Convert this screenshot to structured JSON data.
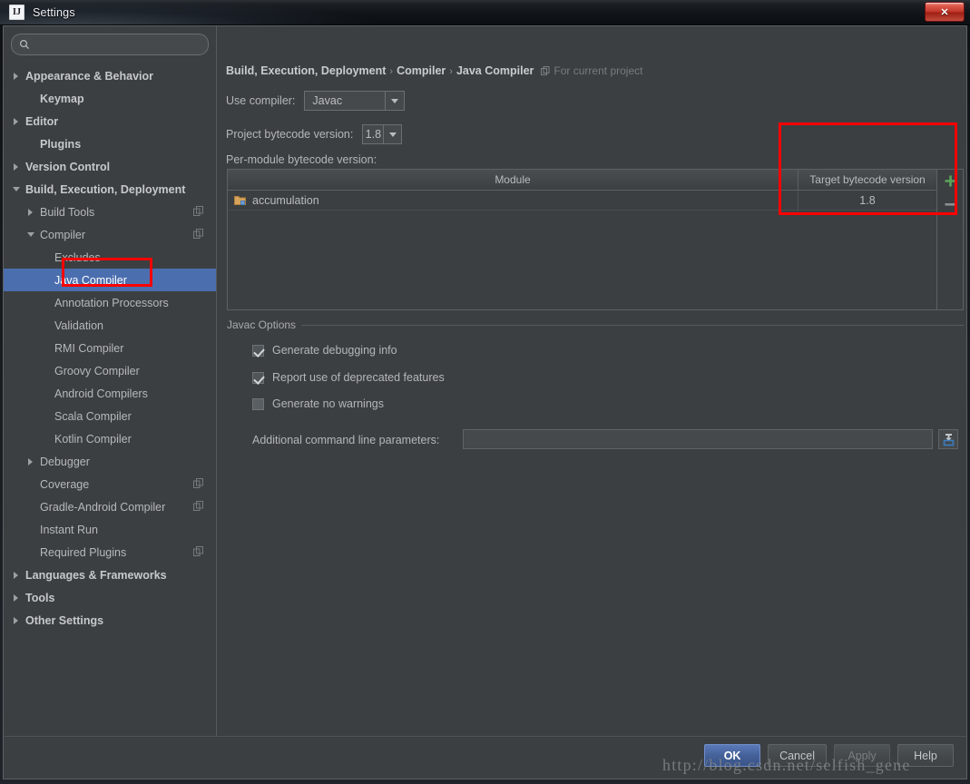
{
  "window": {
    "title": "Settings",
    "logo_text": "IJ",
    "close_label": "✕"
  },
  "search": {
    "value": "",
    "placeholder": "",
    "icon": "search-icon"
  },
  "sidebar": {
    "items": [
      {
        "label": "Appearance & Behavior",
        "indent": 0,
        "twisty": "right",
        "bold": true,
        "copy": false,
        "selected": false
      },
      {
        "label": "Keymap",
        "indent": 1,
        "twisty": "none",
        "bold": true,
        "copy": false,
        "selected": false
      },
      {
        "label": "Editor",
        "indent": 0,
        "twisty": "right",
        "bold": true,
        "copy": false,
        "selected": false
      },
      {
        "label": "Plugins",
        "indent": 1,
        "twisty": "none",
        "bold": true,
        "copy": false,
        "selected": false
      },
      {
        "label": "Version Control",
        "indent": 0,
        "twisty": "right",
        "bold": true,
        "copy": false,
        "selected": false
      },
      {
        "label": "Build, Execution, Deployment",
        "indent": 0,
        "twisty": "down",
        "bold": true,
        "copy": false,
        "selected": false
      },
      {
        "label": "Build Tools",
        "indent": 1,
        "twisty": "right",
        "bold": false,
        "copy": true,
        "selected": false
      },
      {
        "label": "Compiler",
        "indent": 1,
        "twisty": "down",
        "bold": false,
        "copy": true,
        "selected": false
      },
      {
        "label": "Excludes",
        "indent": 2,
        "twisty": "none",
        "bold": false,
        "copy": false,
        "selected": false
      },
      {
        "label": "Java Compiler",
        "indent": 2,
        "twisty": "none",
        "bold": false,
        "copy": false,
        "selected": true
      },
      {
        "label": "Annotation Processors",
        "indent": 2,
        "twisty": "none",
        "bold": false,
        "copy": false,
        "selected": false
      },
      {
        "label": "Validation",
        "indent": 2,
        "twisty": "none",
        "bold": false,
        "copy": false,
        "selected": false
      },
      {
        "label": "RMI Compiler",
        "indent": 2,
        "twisty": "none",
        "bold": false,
        "copy": false,
        "selected": false
      },
      {
        "label": "Groovy Compiler",
        "indent": 2,
        "twisty": "none",
        "bold": false,
        "copy": false,
        "selected": false
      },
      {
        "label": "Android Compilers",
        "indent": 2,
        "twisty": "none",
        "bold": false,
        "copy": false,
        "selected": false
      },
      {
        "label": "Scala Compiler",
        "indent": 2,
        "twisty": "none",
        "bold": false,
        "copy": false,
        "selected": false
      },
      {
        "label": "Kotlin Compiler",
        "indent": 2,
        "twisty": "none",
        "bold": false,
        "copy": false,
        "selected": false
      },
      {
        "label": "Debugger",
        "indent": 1,
        "twisty": "right",
        "bold": false,
        "copy": false,
        "selected": false
      },
      {
        "label": "Coverage",
        "indent": 1,
        "twisty": "none",
        "bold": false,
        "copy": true,
        "selected": false
      },
      {
        "label": "Gradle-Android Compiler",
        "indent": 1,
        "twisty": "none",
        "bold": false,
        "copy": true,
        "selected": false
      },
      {
        "label": "Instant Run",
        "indent": 1,
        "twisty": "none",
        "bold": false,
        "copy": false,
        "selected": false
      },
      {
        "label": "Required Plugins",
        "indent": 1,
        "twisty": "none",
        "bold": false,
        "copy": true,
        "selected": false
      },
      {
        "label": "Languages & Frameworks",
        "indent": 0,
        "twisty": "right",
        "bold": true,
        "copy": false,
        "selected": false
      },
      {
        "label": "Tools",
        "indent": 0,
        "twisty": "right",
        "bold": true,
        "copy": false,
        "selected": false
      },
      {
        "label": "Other Settings",
        "indent": 0,
        "twisty": "right",
        "bold": true,
        "copy": false,
        "selected": false
      }
    ]
  },
  "breadcrumb": {
    "part1": "Build, Execution, Deployment",
    "sep1": "›",
    "part2": "Compiler",
    "sep2": "›",
    "part3": "Java Compiler",
    "scope": "For current project"
  },
  "use_compiler": {
    "label": "Use compiler:",
    "value": "Javac"
  },
  "project_bytecode": {
    "label": "Project bytecode version:",
    "value": "1.8"
  },
  "per_module": {
    "label": "Per-module bytecode version:",
    "columns": [
      "Module",
      "Target bytecode version"
    ],
    "rows": [
      {
        "module": "accumulation",
        "target": "1.8"
      }
    ],
    "add_label": "+",
    "remove_label": "−"
  },
  "javac_options": {
    "group_title": "Javac Options",
    "checkboxes": [
      {
        "label": "Generate debugging info",
        "checked": true
      },
      {
        "label": "Report use of deprecated features",
        "checked": true
      },
      {
        "label": "Generate no warnings",
        "checked": false
      }
    ],
    "additional_label": "Additional command line parameters:",
    "additional_value": "",
    "additional_placeholder": ""
  },
  "footer": {
    "ok": "OK",
    "cancel": "Cancel",
    "apply": "Apply",
    "help": "Help"
  },
  "watermark": {
    "text": "http://blog.csdn.net/selfish_gene"
  },
  "colors": {
    "accent": "#4b6eaf",
    "annotation": "#ff0000",
    "panel_bg": "#3c3f41",
    "plus_green": "#5aa35a"
  }
}
